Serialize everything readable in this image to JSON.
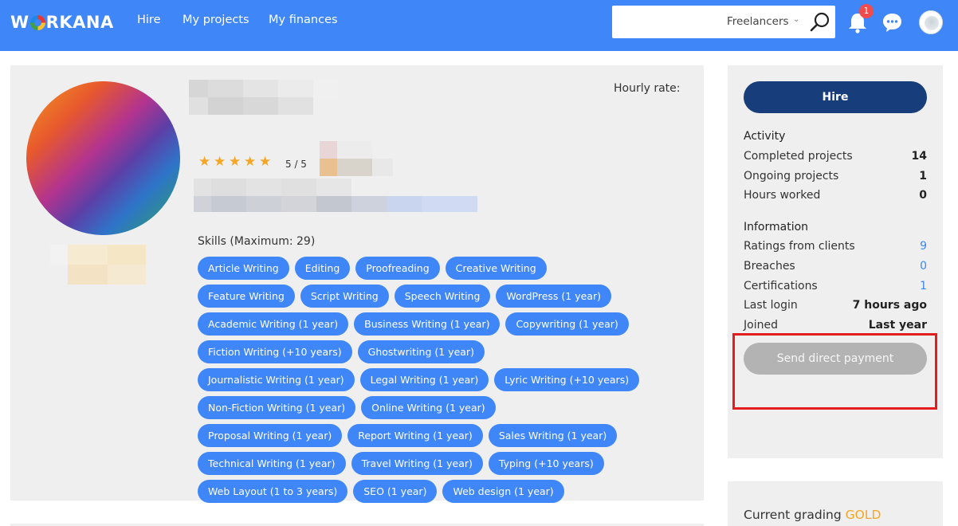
{
  "nav": {
    "logo": "W RKANA",
    "links": [
      "Hire",
      "My projects",
      "My finances"
    ]
  },
  "search": {
    "placeholder": "",
    "filter_label": "Freelancers"
  },
  "notifications": {
    "count": "1"
  },
  "colors": {
    "brand_blue": "#3f86f8",
    "hire_button": "#173d7a",
    "disabled_button": "#b3b3b3",
    "highlight": "#e31d1d",
    "gold": "#f5a623"
  },
  "profile": {
    "hourly_rate_label": "Hourly rate:",
    "rating_stars": 5,
    "rating_text": "5 / 5",
    "skills_title": "Skills (Maximum: 29)",
    "skills": [
      "Article Writing",
      "Editing",
      "Proofreading",
      "Creative Writing",
      "Feature Writing",
      "Script Writing",
      "Speech Writing",
      "WordPress (1 year)",
      "Academic Writing (1 year)",
      "Business Writing (1 year)",
      "Copywriting (1 year)",
      "Fiction Writing (+10 years)",
      "Ghostwriting (1 year)",
      "Journalistic Writing (1 year)",
      "Legal Writing (1 year)",
      "Lyric Writing (+10 years)",
      "Non-Fiction Writing (1 year)",
      "Online Writing (1 year)",
      "Proposal Writing (1 year)",
      "Report Writing (1 year)",
      "Sales Writing (1 year)",
      "Technical Writing (1 year)",
      "Travel Writing (1 year)",
      "Typing (+10 years)",
      "Web Layout (1 to 3 years)",
      "SEO (1 year)",
      "Web design (1 year)"
    ]
  },
  "sidebar": {
    "hire_label": "Hire",
    "activity_title": "Activity",
    "activity": [
      {
        "label": "Completed projects",
        "value": "14"
      },
      {
        "label": "Ongoing projects",
        "value": "1"
      },
      {
        "label": "Hours worked",
        "value": "0"
      }
    ],
    "information_title": "Information",
    "information": [
      {
        "label": "Ratings from clients",
        "value": "9",
        "link": true
      },
      {
        "label": "Breaches",
        "value": "0",
        "link": true
      },
      {
        "label": "Certifications",
        "value": "1",
        "link": true
      },
      {
        "label": "Last login",
        "value": "7 hours ago",
        "link": false
      },
      {
        "label": "Joined",
        "value": "Last year",
        "link": false
      }
    ],
    "send_payment_label": "Send direct payment"
  },
  "grading": {
    "label": "Current grading",
    "value": "GOLD"
  }
}
